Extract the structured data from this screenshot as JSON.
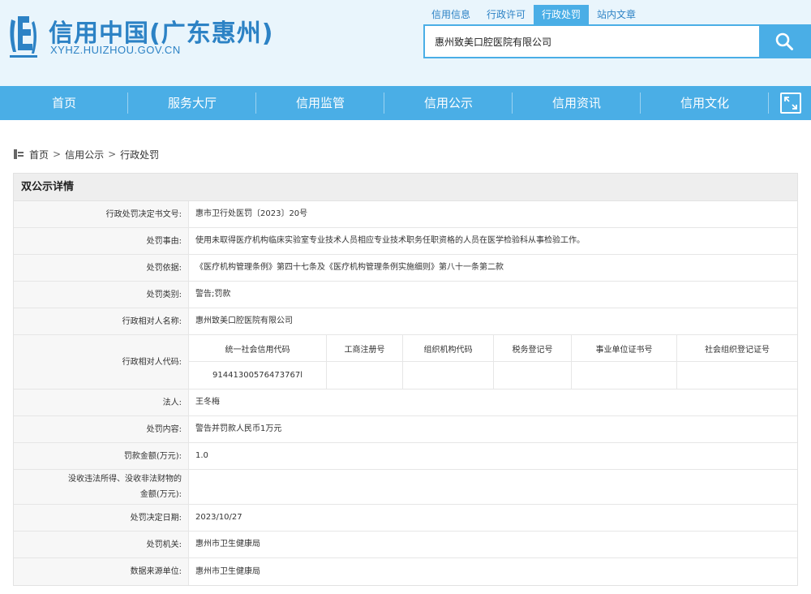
{
  "header": {
    "title": "信用中国(广东惠州)",
    "url": "XYHZ.HUIZHOU.GOV.CN"
  },
  "search": {
    "tabs": [
      {
        "label": "信用信息",
        "active": false
      },
      {
        "label": "行政许可",
        "active": false
      },
      {
        "label": "行政处罚",
        "active": true
      },
      {
        "label": "站内文章",
        "active": false
      }
    ],
    "value": "惠州致美口腔医院有限公司"
  },
  "nav": {
    "items": [
      "首页",
      "服务大厅",
      "信用监管",
      "信用公示",
      "信用资讯",
      "信用文化"
    ]
  },
  "breadcrumb": {
    "items": [
      "首页",
      "信用公示",
      "行政处罚"
    ],
    "separator": ">"
  },
  "panel": {
    "title": "双公示详情",
    "rows": {
      "decision_no": {
        "label": "行政处罚决定书文号:",
        "value": "惠市卫行处医罚〔2023〕20号"
      },
      "reason": {
        "label": "处罚事由:",
        "value": "使用未取得医疗机构临床实验室专业技术人员相应专业技术职务任职资格的人员在医学检验科从事检验工作。"
      },
      "basis": {
        "label": "处罚依据:",
        "value": "《医疗机构管理条例》第四十七条及《医疗机构管理条例实施细则》第八十一条第二款"
      },
      "category": {
        "label": "处罚类别:",
        "value": "警告;罚款"
      },
      "party_name": {
        "label": "行政相对人名称:",
        "value": "惠州致美口腔医院有限公司"
      },
      "party_code": {
        "label": "行政相对人代码:",
        "headers": [
          "统一社会信用代码",
          "工商注册号",
          "组织机构代码",
          "税务登记号",
          "事业单位证书号",
          "社会组织登记证号"
        ],
        "values": [
          "91441300576473767l",
          "",
          "",
          "",
          "",
          ""
        ]
      },
      "legal_person": {
        "label": "法人:",
        "value": "王冬梅"
      },
      "content": {
        "label": "处罚内容:",
        "value": "警告并罚款人民币1万元"
      },
      "fine": {
        "label": "罚款金额(万元):",
        "value": "1.0"
      },
      "confiscation": {
        "label_line1": "没收违法所得、没收非法财物的",
        "label_line2": "金额(万元):",
        "value": ""
      },
      "date": {
        "label": "处罚决定日期:",
        "value": "2023/10/27"
      },
      "authority": {
        "label": "处罚机关:",
        "value": "惠州市卫生健康局"
      },
      "source": {
        "label": "数据来源单位:",
        "value": "惠州市卫生健康局"
      }
    }
  },
  "colors": {
    "brand_blue": "#2c82c5",
    "nav_blue": "#4aaee6",
    "header_bg": "#e9f5fc",
    "label_bg": "#f7f7f7"
  },
  "icons": [
    "logo-mark-icon",
    "search-icon",
    "expand-icon",
    "location-icon"
  ]
}
